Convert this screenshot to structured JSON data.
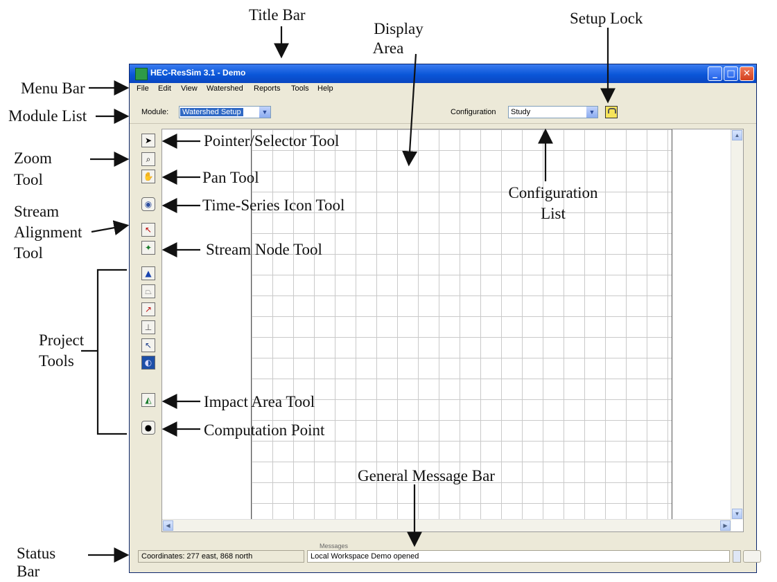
{
  "window": {
    "title": "HEC-ResSim 3.1  - Demo",
    "controls": [
      "minimize",
      "maximize",
      "close"
    ]
  },
  "menu": [
    "File",
    "Edit",
    "View",
    "Watershed",
    "Reports",
    "Tools",
    "Help"
  ],
  "module": {
    "label": "Module:",
    "value": "Watershed Setup"
  },
  "configuration": {
    "label": "Configuration",
    "value": "Study"
  },
  "status": {
    "coordinates": "Coordinates: 277 east, 868 north",
    "message_label": "Messages",
    "message": "Local Workspace Demo opened"
  },
  "tools": [
    {
      "name": "pointer-selector-tool",
      "icon": "pointer-icon"
    },
    {
      "name": "zoom-tool",
      "icon": "magnifier-icon"
    },
    {
      "name": "pan-tool",
      "icon": "hand-icon"
    },
    {
      "name": "time-series-icon-tool",
      "icon": "time-series-icon"
    },
    {
      "name": "stream-alignment-tool",
      "icon": "stream-alignment-icon"
    },
    {
      "name": "stream-node-tool",
      "icon": "stream-node-icon"
    },
    {
      "name": "reservoir-tool",
      "icon": "triangle-icon"
    },
    {
      "name": "dam-tool",
      "icon": "trapezoid-icon"
    },
    {
      "name": "diversion-tool",
      "icon": "diagonal-arrow-icon"
    },
    {
      "name": "gage-tool",
      "icon": "gage-icon"
    },
    {
      "name": "project-tool",
      "icon": "arrow-icon"
    },
    {
      "name": "globe-tool",
      "icon": "globe-icon"
    },
    {
      "name": "impact-area-tool",
      "icon": "impact-area-icon"
    },
    {
      "name": "computation-point-tool",
      "icon": "black-circle-icon"
    }
  ],
  "annotations": {
    "title_bar": "Title Bar",
    "display_area_1": "Display",
    "display_area_2": "Area",
    "setup_lock": "Setup Lock",
    "menu_bar": "Menu Bar",
    "module_list": "Module List",
    "pointer_tool": "Pointer/Selector Tool",
    "zoom_tool_1": "Zoom",
    "zoom_tool_2": "Tool",
    "pan_tool": "Pan Tool",
    "time_series_tool": "Time-Series Icon Tool",
    "stream_alignment_1": "Stream",
    "stream_alignment_2": "Alignment",
    "stream_alignment_3": "Tool",
    "stream_node_tool": "Stream Node Tool",
    "configuration_list_1": "Configuration",
    "configuration_list_2": "List",
    "project_tools_1": "Project",
    "project_tools_2": "Tools",
    "impact_area_tool": "Impact Area Tool",
    "computation_point": "Computation Point",
    "general_message_bar": "General Message Bar",
    "status_bar_1": "Status",
    "status_bar_2": "Bar"
  }
}
